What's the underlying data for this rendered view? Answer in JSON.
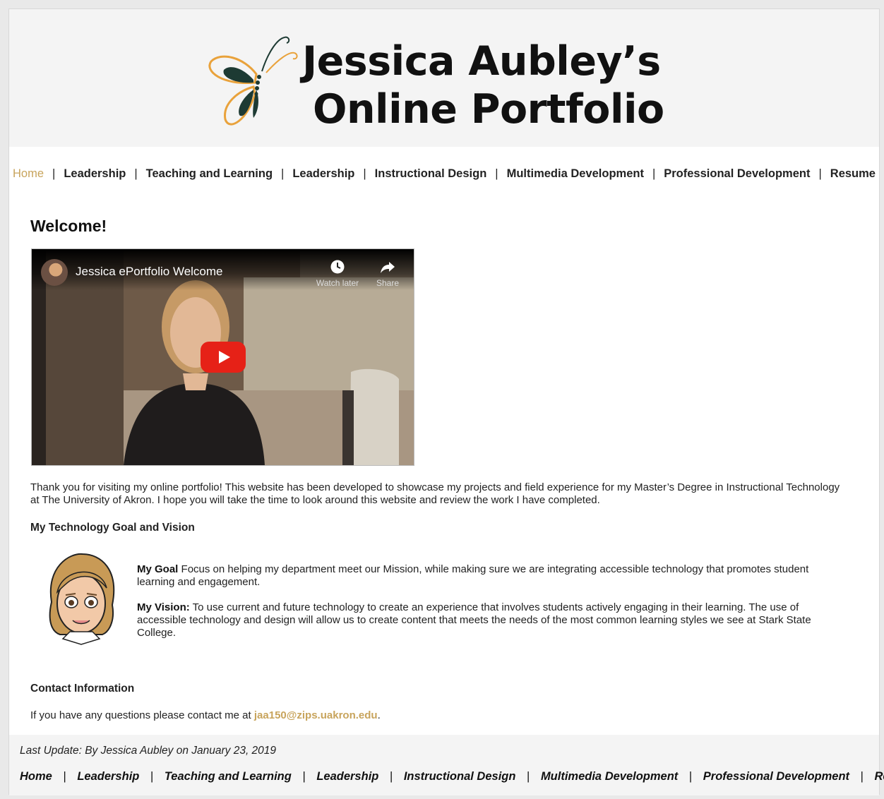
{
  "banner": {
    "title_line1": "Jessica Aubley’s",
    "title_line2": "Online Portfolio",
    "accent_color": "#e9a23b",
    "dark_color": "#1d3a33"
  },
  "nav": {
    "items": [
      {
        "label": "Home",
        "active": true
      },
      {
        "label": "Leadership"
      },
      {
        "label": "Teaching and Learning"
      },
      {
        "label": "Leadership"
      },
      {
        "label": "Instructional Design"
      },
      {
        "label": "Multimedia Development"
      },
      {
        "label": "Professional Development"
      },
      {
        "label": "Resume"
      }
    ],
    "separator": "|"
  },
  "main": {
    "heading": "Welcome!",
    "video": {
      "title": "Jessica ePortfolio Welcome",
      "watch_later_label": "Watch later",
      "share_label": "Share",
      "watch_later_icon": "clock-icon",
      "share_icon": "share-arrow-icon",
      "play_icon": "youtube-play-icon"
    },
    "intro": "Thank you for visiting my online portfolio! This website has been developed to showcase my projects and field experience for my Master’s Degree in Instructional Technology at The University of Akron. I hope you will take the time to look around this website and review the work I have completed.",
    "goal_heading": "My Technology Goal and Vision",
    "goal_label": "My Goal",
    "goal_text": " Focus on helping my department meet our Mission, while making sure we are integrating accessible technology that promotes student learning and engagement.",
    "vision_label": "My Vision:",
    "vision_text": " To use current and future technology to create an experience that involves students actively engaging in their learning. The use of accessible technology and design will allow us to create content that meets the needs of the most common learning styles we see at Stark State College.",
    "contact_heading": "Contact Information",
    "contact_prefix": "If you have any questions please contact me at ",
    "contact_email": "jaa150@zips.uakron.edu",
    "contact_suffix": ".",
    "link_color": "#c8a45c"
  },
  "footer": {
    "last_update": "Last Update: By Jessica Aubley on January 23, 2019",
    "items": [
      "Home",
      "Leadership",
      "Teaching and Learning",
      "Leadership",
      "Instructional Design",
      "Multimedia Development",
      "Professional Development",
      "Resume"
    ],
    "separator": "|"
  }
}
